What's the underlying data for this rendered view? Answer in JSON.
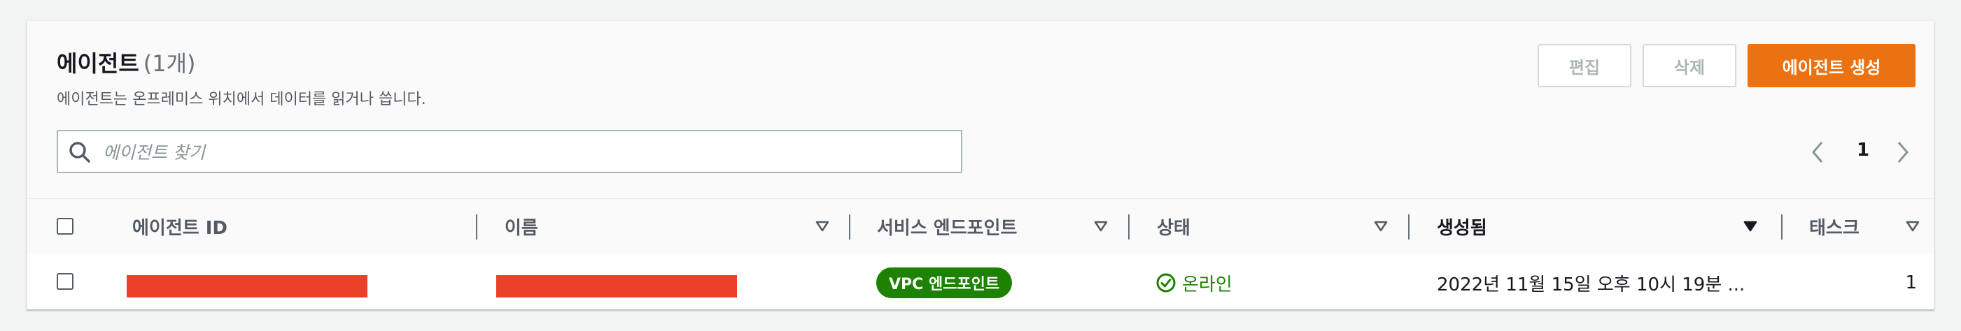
{
  "header": {
    "title": "에이전트",
    "count": "(1개)",
    "description": "에이전트는 온프레미스 위치에서 데이터를 읽거나 씁니다."
  },
  "actions": {
    "edit_label": "편집",
    "delete_label": "삭제",
    "create_label": "에이전트 생성"
  },
  "search": {
    "placeholder": "에이전트 찾기",
    "value": ""
  },
  "pagination": {
    "current_page": "1"
  },
  "table": {
    "columns": [
      {
        "label": "에이전트 ID"
      },
      {
        "label": "이름"
      },
      {
        "label": "서비스 엔드포인트"
      },
      {
        "label": "상태"
      },
      {
        "label": "생성됨"
      },
      {
        "label": "태스크"
      }
    ],
    "rows": [
      {
        "service_endpoint": "VPC 엔드포인트",
        "status": "온라인",
        "created": "2022년 11월 15일 오후 10시 19분 ...",
        "tasks": "1"
      }
    ]
  },
  "colors": {
    "primary": "#ec7211",
    "success": "#1d8102",
    "redaction": "#ea4128"
  },
  "icons": [
    "search-icon",
    "chevron-left-icon",
    "chevron-right-icon",
    "sort-icon",
    "status-positive-icon"
  ]
}
